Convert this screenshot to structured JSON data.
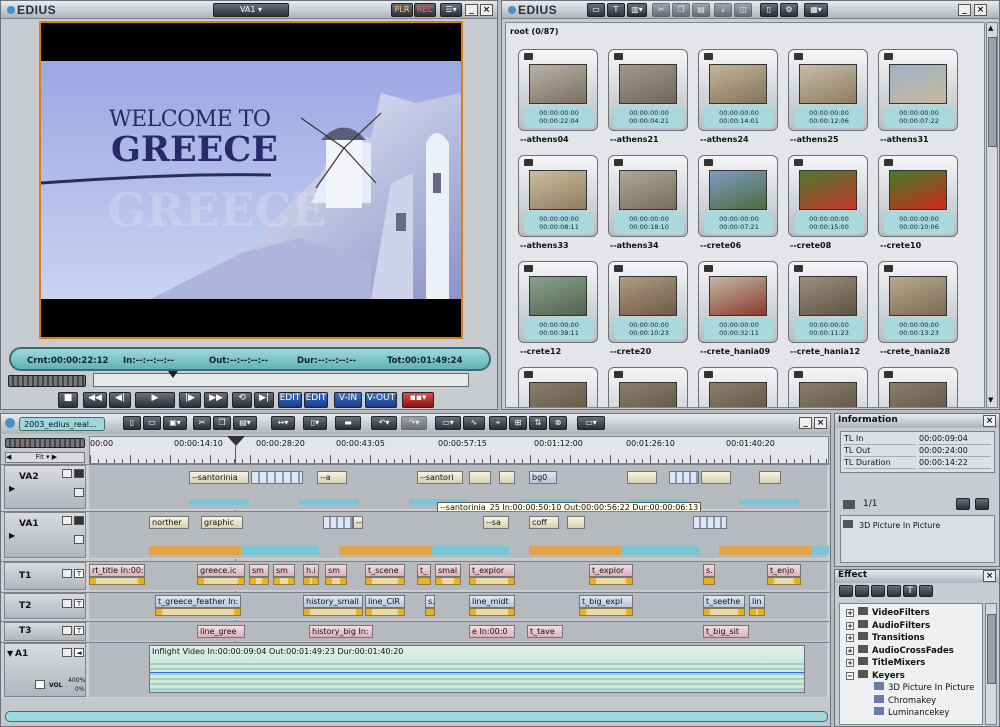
{
  "player": {
    "app": "EDIUS",
    "channel": "VA1",
    "plr": "PLR",
    "rec": "REC",
    "title_line1": "WELCOME TO",
    "title_line2": "GREECE",
    "watermark": "GREECE",
    "crnt": "Crnt:00:00:22:12",
    "in": "In:--:--:--:--",
    "out": "Out:--:--:--:--",
    "dur": "Dur:--:--:--:--",
    "tot": "Tot:00:01:49:24",
    "edit_a": "EDIT",
    "edit_b": "EDIT",
    "vin": "V-IN",
    "vout": "V-OUT"
  },
  "bin": {
    "app": "EDIUS",
    "path": "root (0/87)",
    "clips": [
      {
        "name": "--athens04",
        "tc1": "00:00:00:00",
        "tc2": "00:00:22:04"
      },
      {
        "name": "--athens21",
        "tc1": "00:00:00:00",
        "tc2": "00:00:04:21"
      },
      {
        "name": "--athens24",
        "tc1": "00:00:00:00",
        "tc2": "00:00:14:01"
      },
      {
        "name": "--athens25",
        "tc1": "00:00:00:00",
        "tc2": "00:00:12:06"
      },
      {
        "name": "--athens31",
        "tc1": "00:00:00:00",
        "tc2": "00:00:07:22"
      },
      {
        "name": "--athens33",
        "tc1": "00:00:00:00",
        "tc2": "00:00:08:11"
      },
      {
        "name": "--athens34",
        "tc1": "00:00:00:00",
        "tc2": "00:00:18:10"
      },
      {
        "name": "--crete06",
        "tc1": "00:00:00:00",
        "tc2": "00:00:07:21"
      },
      {
        "name": "--crete08",
        "tc1": "00:00:00:00",
        "tc2": "00:00:15:00"
      },
      {
        "name": "--crete10",
        "tc1": "00:00:00:00",
        "tc2": "00:00:10:06"
      },
      {
        "name": "--crete12",
        "tc1": "00:00:00:00",
        "tc2": "00:00:39:11"
      },
      {
        "name": "--crete20",
        "tc1": "00:00:00:00",
        "tc2": "00:00:10:23"
      },
      {
        "name": "--crete_hania09",
        "tc1": "00:00:00:00",
        "tc2": "00:00:32:11"
      },
      {
        "name": "--crete_hania12",
        "tc1": "00:00:00:00",
        "tc2": "00:00:11:23"
      },
      {
        "name": "--crete_hania28",
        "tc1": "00:00:00:00",
        "tc2": "00:00:13:23"
      }
    ]
  },
  "timeline": {
    "project": "2003_edius_real...",
    "fit": "Fit",
    "ruler": [
      "00:00",
      "00:00:14:10",
      "00:00:28:20",
      "00:00:43:05",
      "00:00:57:15",
      "00:01:12:00",
      "00:01:26:10",
      "00:01:40:20"
    ],
    "tracks": [
      "VA2",
      "VA1",
      "T1",
      "T2",
      "T3",
      "A1"
    ],
    "tooltip": "--santorinia_25 In:00:00:50:10 Out:00:00:56:22 Dur:00:00:06:13",
    "va2": [
      "--santorinia",
      "--a",
      "--santori",
      "bg0"
    ],
    "va1": [
      "norther",
      "graphic",
      "--a",
      "--sa",
      "coff"
    ],
    "t1": [
      "rt_title In:00:",
      "greece.ic",
      "sm",
      "sm",
      "h.i",
      "sm",
      "t_scene",
      "t_",
      "smal",
      "t_explor",
      "t_explor",
      "s.",
      "t_enjo"
    ],
    "t2": [
      "t_greece_feather In:",
      "history_small",
      "line_CIR",
      "s.",
      "line_midt",
      "t_big_expl",
      "t_seethe",
      "lin"
    ],
    "t3": [
      "line_gree",
      "history_big In:",
      "e In:00:0",
      "t_tave",
      "t_big_sit"
    ],
    "a1": "Inflight Video In:00:00:09:04 Out:00:01:49:23 Dur:00:01:40:20",
    "vol": "VOL",
    "pct1": "400%",
    "pct2": "0%"
  },
  "information": {
    "title": "Information",
    "rows": [
      [
        "TL In",
        "00:00:09:04"
      ],
      [
        "TL Out",
        "00:00:24:00"
      ],
      [
        "TL Duration",
        "00:00:14:22"
      ]
    ],
    "page": "1/1",
    "effect": "3D Picture In Picture"
  },
  "effect": {
    "title": "Effect",
    "items": [
      "VideoFilters",
      "AudioFilters",
      "Transitions",
      "AudioCrossFades",
      "TitleMixers",
      "Keyers",
      "3D Picture In Picture",
      "Chromakey",
      "Luminancekey"
    ]
  }
}
